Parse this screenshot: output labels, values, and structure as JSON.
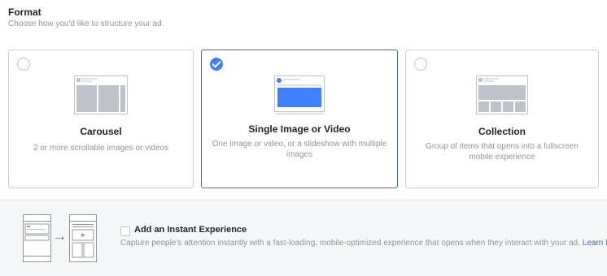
{
  "format": {
    "title": "Format",
    "subtitle": "Choose how you'd like to structure your ad."
  },
  "options": [
    {
      "title": "Carousel",
      "description": "2 or more scrollable images or videos",
      "selected": false,
      "icon": "carousel-preview-icon"
    },
    {
      "title": "Single Image or Video",
      "description": "One image or video, or a slideshow with multiple images",
      "selected": true,
      "icon": "single-image-preview-icon"
    },
    {
      "title": "Collection",
      "description": "Group of items that opens into a fullscreen mobile experience",
      "selected": false,
      "icon": "collection-preview-icon"
    }
  ],
  "instant_experience": {
    "title": "Add an Instant Experience",
    "description": "Capture people's attention instantly with a fast-loading, mobile-optimized experience that opens when they interact with your ad.",
    "link_label": "Learn More",
    "checked": false,
    "icon": "instant-experience-preview-icon"
  },
  "colors": {
    "accent": "#4080ff",
    "selected_border": "#4267b2",
    "link": "#4267b2",
    "muted_text": "#90949c",
    "panel_bg": "#f5f6f7"
  }
}
